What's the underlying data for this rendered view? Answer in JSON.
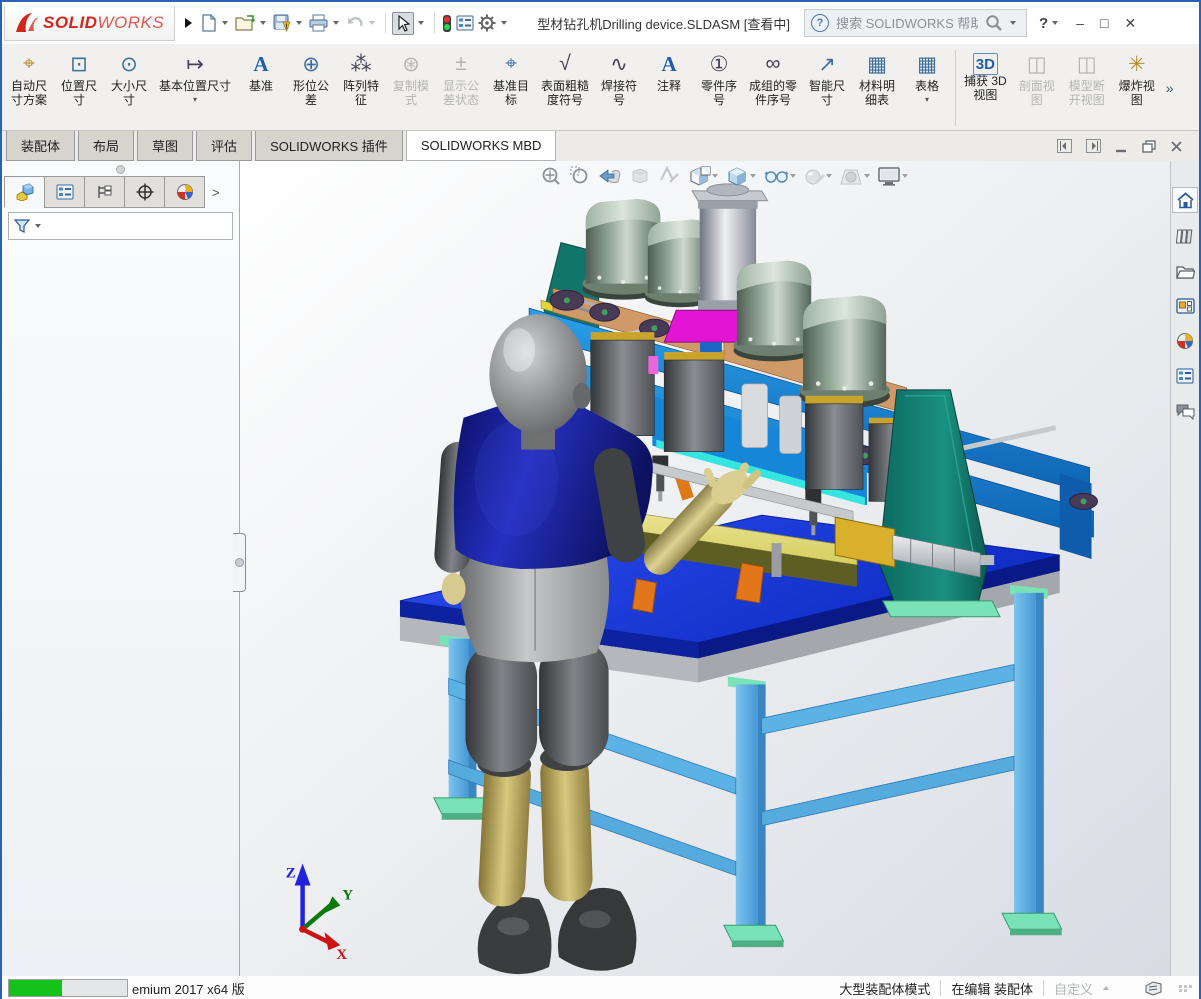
{
  "titlebar": {
    "logo": "SOLIDWORKS",
    "logo_bold": "SOLID",
    "logo_light": "WORKS",
    "title": "型材钻孔机Drilling device.SLDASM [查看中]",
    "search_placeholder": "搜索 SOLIDWORKS 帮助",
    "help": "?",
    "minimize": "–",
    "maximize": "□",
    "close": "✕",
    "quick_tool_icons": [
      "new-document",
      "open",
      "save",
      "print",
      "undo",
      "select-cursor",
      "rebuild-stoplight",
      "options-list",
      "settings-gear"
    ]
  },
  "ribbon": {
    "overflow": "»",
    "buttons": [
      {
        "name": "auto-dimension-scheme",
        "label": "自动尺\n寸方案",
        "glyph": "⌖",
        "disabled": false
      },
      {
        "name": "location-dimension",
        "label": "位置尺\n寸",
        "glyph": "⊡",
        "disabled": false
      },
      {
        "name": "size-dimension",
        "label": "大小尺\n寸",
        "glyph": "⊙",
        "disabled": false
      },
      {
        "name": "basic-location-dimension",
        "label": "基本位置尺寸",
        "glyph": "↦",
        "disabled": false,
        "dropdown": true
      },
      {
        "name": "datum",
        "label": "基准",
        "glyph": "A",
        "disabled": false
      },
      {
        "name": "geometric-tolerance",
        "label": "形位公\n差",
        "glyph": "⊕",
        "disabled": false
      },
      {
        "name": "pattern-feature",
        "label": "阵列特\n征",
        "glyph": "⁂",
        "disabled": false
      },
      {
        "name": "copy-scheme",
        "label": "复制模\n式",
        "glyph": "⊛",
        "disabled": true
      },
      {
        "name": "show-tolerance-status",
        "label": "显示公\n差状态",
        "glyph": "±",
        "disabled": true
      },
      {
        "name": "datum-target",
        "label": "基准目\n标",
        "glyph": "⌖",
        "disabled": false
      },
      {
        "name": "surface-finish-symbol",
        "label": "表面粗糙\n度符号",
        "glyph": "√",
        "disabled": false
      },
      {
        "name": "weld-symbol",
        "label": "焊接符\n号",
        "glyph": "∿",
        "disabled": false
      },
      {
        "name": "note",
        "label": "注释",
        "glyph": "A",
        "disabled": false
      },
      {
        "name": "balloon",
        "label": "零件序\n号",
        "glyph": "①",
        "disabled": false
      },
      {
        "name": "stacked-balloon",
        "label": "成组的零\n件序号",
        "glyph": "∞",
        "disabled": false
      },
      {
        "name": "smart-dimension",
        "label": "智能尺\n寸",
        "glyph": "↗",
        "disabled": false
      },
      {
        "name": "bill-of-materials",
        "label": "材料明\n细表",
        "glyph": "▦",
        "disabled": false
      },
      {
        "name": "tables",
        "label": "表格",
        "glyph": "▦",
        "disabled": false,
        "dropdown": true
      },
      {
        "name": "capture-3d-view",
        "label": "捕获 3D\n视图",
        "glyph": "3D",
        "disabled": false
      },
      {
        "name": "section-view",
        "label": "剖面视\n图",
        "glyph": "◫",
        "disabled": true
      },
      {
        "name": "model-break-view",
        "label": "模型断\n开视图",
        "glyph": "◫",
        "disabled": true
      },
      {
        "name": "exploded-view",
        "label": "爆炸视\n图",
        "glyph": "✳",
        "disabled": false
      }
    ]
  },
  "tabs": {
    "items": [
      {
        "label": "装配体"
      },
      {
        "label": "布局"
      },
      {
        "label": "草图"
      },
      {
        "label": "评估"
      },
      {
        "label": "SOLIDWORKS 插件"
      },
      {
        "label": "SOLIDWORKS MBD"
      }
    ],
    "active": "SOLIDWORKS MBD"
  },
  "left_panel": {
    "tab_icons": [
      "featuremanager-tree",
      "propertymanager",
      "configurationmanager",
      "dimxpertmanager",
      "displaymanager"
    ],
    "expand": ">",
    "filter_icon": "filter-funnel"
  },
  "viewport": {
    "headsup_icons": [
      "zoom-to-fit",
      "zoom-to-area",
      "previous-view",
      "section-view",
      "dynamic-annotation-views",
      "view-orientation",
      "display-style",
      "hide-show-items",
      "edit-appearance",
      "apply-scene",
      "view-settings"
    ],
    "triad": {
      "x": "X",
      "y": "Y",
      "z": "Z"
    }
  },
  "task_pane": {
    "icons": [
      "home",
      "design-library",
      "file-explorer",
      "view-palette",
      "appearances-scenes",
      "custom-properties",
      "forum"
    ]
  },
  "statusbar": {
    "progress_percent": 45,
    "version": "emium 2017 x64 版",
    "mode": "大型装配体模式",
    "edit_state": "在编辑 装配体",
    "customize": "自定义"
  },
  "palette": {
    "window_border": "#2a61b0",
    "table_top_blue": "#1a3ce4",
    "table_edge_navy": "#0a1f9e",
    "leg_blue": "#5bb2e4",
    "foot_mint": "#79e2b6",
    "frame_blue": "#1686d8",
    "motor_sage": "#9fb3a2",
    "plate_copper": "#cf9a68",
    "rail_yellow": "#e6d23e",
    "cylinder_silver": "#c8ccd2",
    "plate_magenta": "#e215d4",
    "gusset_teal": "#13796d",
    "workpiece_yellow": "#e9e388",
    "shirt_navy": "#1b2390",
    "skin_tan": "#d9cd90",
    "shin_khaki": "#b3a15c",
    "logo_red": "#d3261c"
  }
}
